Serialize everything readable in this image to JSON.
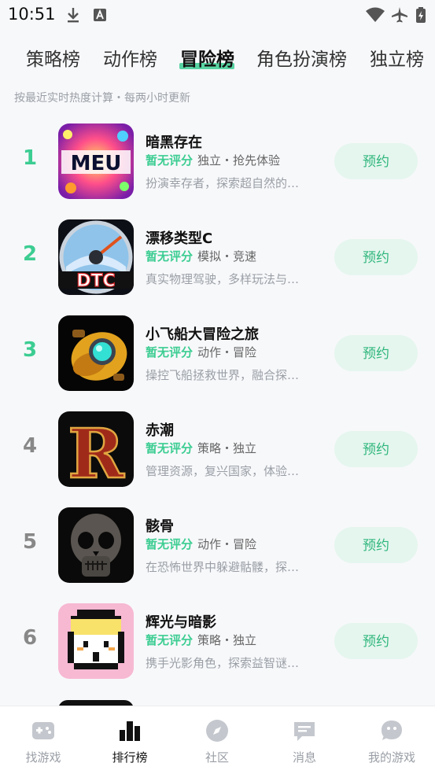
{
  "status_bar": {
    "time": "10:51",
    "icons": [
      "download-icon",
      "text-a-icon",
      "wifi-icon",
      "airplane-icon",
      "battery-charging-icon"
    ]
  },
  "tabs": [
    {
      "label": "策略榜",
      "active": false
    },
    {
      "label": "动作榜",
      "active": false
    },
    {
      "label": "冒险榜",
      "active": true
    },
    {
      "label": "角色扮演榜",
      "active": false
    },
    {
      "label": "独立榜",
      "active": false
    }
  ],
  "subtitle": "按最近实时热度计算・每两小时更新",
  "games": [
    {
      "rank": "1",
      "name": "暗黑存在",
      "rating": "暂无评分",
      "tags": "独立・抢先体验",
      "desc": "扮演幸存者，探索超自然的…",
      "button": "预约",
      "icon_name": "meu-game-icon",
      "icon_text": "MEU"
    },
    {
      "rank": "2",
      "name": "漂移类型C",
      "rating": "暂无评分",
      "tags": "模拟・竞速",
      "desc": "真实物理驾驶，多样玩法与…",
      "button": "预约",
      "icon_name": "speedometer-game-icon",
      "icon_text": "DTC"
    },
    {
      "rank": "3",
      "name": "小飞船大冒险之旅",
      "rating": "暂无评分",
      "tags": "动作・冒险",
      "desc": "操控飞船拯救世界，融合探…",
      "button": "预约",
      "icon_name": "spaceship-game-icon"
    },
    {
      "rank": "4",
      "name": "赤潮",
      "rating": "暂无评分",
      "tags": "策略・独立",
      "desc": "管理资源，复兴国家，体验…",
      "button": "预约",
      "icon_name": "letter-r-game-icon",
      "icon_text": "R"
    },
    {
      "rank": "5",
      "name": "骸骨",
      "rating": "暂无评分",
      "tags": "动作・冒险",
      "desc": "在恐怖世界中躲避骷髅，探…",
      "button": "预约",
      "icon_name": "skull-game-icon"
    },
    {
      "rank": "6",
      "name": "辉光与暗影",
      "rating": "暂无评分",
      "tags": "策略・独立",
      "desc": "携手光影角色，探索益智谜…",
      "button": "预约",
      "icon_name": "pixel-character-game-icon"
    }
  ],
  "bottom_nav": [
    {
      "label": "找游戏",
      "icon": "gamepad-icon",
      "active": false
    },
    {
      "label": "排行榜",
      "icon": "ranking-bars-icon",
      "active": true
    },
    {
      "label": "社区",
      "icon": "compass-icon",
      "active": false
    },
    {
      "label": "消息",
      "icon": "message-icon",
      "active": false
    },
    {
      "label": "我的游戏",
      "icon": "my-games-icon",
      "active": false
    }
  ],
  "colors": {
    "accent": "#3ccd92",
    "button_bg": "#e5f6ee",
    "button_text": "#2fb67c"
  }
}
